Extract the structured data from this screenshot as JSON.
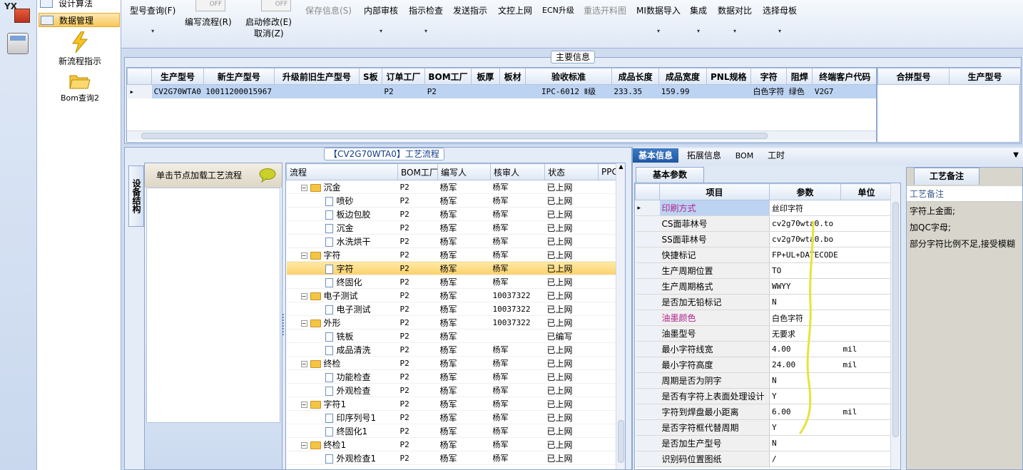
{
  "app": {
    "logo": "YX"
  },
  "nav": {
    "item1": "设计算法",
    "item2": "数据管理",
    "btn1": "新流程指示",
    "btn2": "Bom查询2"
  },
  "toolbar": {
    "b1": "型号查询(F)",
    "b2": "编写流程(R)",
    "b3": "启动修改(E)",
    "b3b": "取消(Z)",
    "b4": "保存信息(S)",
    "b5": "内部审核",
    "b6": "指示检查",
    "b7": "发送指示",
    "b8": "文控上网",
    "b9": "ECN升级",
    "b10": "重选开料图",
    "b11": "MI数据导入",
    "b12": "集成",
    "b13": "数据对比",
    "b14": "选择母板",
    "toggle": "OFF"
  },
  "main_info": {
    "caption": "主要信息",
    "headers": [
      "生产型号",
      "新生产型号",
      "升级前旧生产型号",
      "S板",
      "订单工厂",
      "BOM工厂",
      "板厚",
      "板材",
      "验收标准",
      "成品长度",
      "成品宽度",
      "PNL规格",
      "字符",
      "阻焊",
      "终端客户代码"
    ],
    "row": [
      "CV2G70WTA0",
      "10011200015967",
      "",
      "",
      "P2",
      "P2",
      "",
      "",
      "IPC-6012 Ⅱ级",
      "233.35",
      "159.99",
      "",
      "白色字符",
      "绿色",
      "V2G7"
    ],
    "side_headers": [
      "合拼型号",
      "生产型号"
    ]
  },
  "flow": {
    "caption": "【CV2G70WTA0】工艺流程",
    "side_tab": "设备结构",
    "hint": "单击节点加载工艺流程",
    "headers": [
      "流程",
      "BOM工厂",
      "编写人",
      "核审人",
      "状态",
      "PPC"
    ],
    "rows": [
      {
        "name": "沉金",
        "level": 0,
        "bom": "P2",
        "writer": "杨军",
        "checker": "杨军",
        "status": "已上网"
      },
      {
        "name": "喷砂",
        "level": 1,
        "bom": "P2",
        "writer": "杨军",
        "checker": "杨军",
        "status": "已上网"
      },
      {
        "name": "板边包胶",
        "level": 1,
        "bom": "P2",
        "writer": "杨军",
        "checker": "杨军",
        "status": "已上网"
      },
      {
        "name": "沉金",
        "level": 1,
        "bom": "P2",
        "writer": "杨军",
        "checker": "杨军",
        "status": "已上网"
      },
      {
        "name": "水洗烘干",
        "level": 1,
        "bom": "P2",
        "writer": "杨军",
        "checker": "杨军",
        "status": "已上网"
      },
      {
        "name": "字符",
        "level": 0,
        "bom": "P2",
        "writer": "杨军",
        "checker": "杨军",
        "status": "已上网"
      },
      {
        "name": "字符",
        "level": 1,
        "bom": "P2",
        "writer": "杨军",
        "checker": "杨军",
        "status": "已上网",
        "hl": true
      },
      {
        "name": "终固化",
        "level": 1,
        "bom": "P2",
        "writer": "杨军",
        "checker": "杨军",
        "status": "已上网"
      },
      {
        "name": "电子测试",
        "level": 0,
        "bom": "P2",
        "writer": "杨军",
        "checker": "10037322",
        "status": "已上网"
      },
      {
        "name": "电子测试",
        "level": 1,
        "bom": "P2",
        "writer": "杨军",
        "checker": "10037322",
        "status": "已上网"
      },
      {
        "name": "外形",
        "level": 0,
        "bom": "P2",
        "writer": "杨军",
        "checker": "10037322",
        "status": "已上网"
      },
      {
        "name": "铣板",
        "level": 1,
        "bom": "P2",
        "writer": "杨军",
        "checker": "",
        "status": "已编写"
      },
      {
        "name": "成品清洗",
        "level": 1,
        "bom": "P2",
        "writer": "杨军",
        "checker": "杨军",
        "status": "已上网"
      },
      {
        "name": "终检",
        "level": 0,
        "bom": "P2",
        "writer": "杨军",
        "checker": "杨军",
        "status": "已上网"
      },
      {
        "name": "功能检查",
        "level": 1,
        "bom": "P2",
        "writer": "杨军",
        "checker": "杨军",
        "status": "已上网"
      },
      {
        "name": "外观检查",
        "level": 1,
        "bom": "P2",
        "writer": "杨军",
        "checker": "杨军",
        "status": "已上网"
      },
      {
        "name": "字符1",
        "level": 0,
        "bom": "P2",
        "writer": "杨军",
        "checker": "杨军",
        "status": "已上网"
      },
      {
        "name": "印序列号1",
        "level": 1,
        "bom": "P2",
        "writer": "杨军",
        "checker": "杨军",
        "status": "已上网"
      },
      {
        "name": "终固化1",
        "level": 1,
        "bom": "P2",
        "writer": "杨军",
        "checker": "杨军",
        "status": "已上网"
      },
      {
        "name": "终检1",
        "level": 0,
        "bom": "P2",
        "writer": "杨军",
        "checker": "杨军",
        "status": "已上网"
      },
      {
        "name": "外观检查1",
        "level": 1,
        "bom": "P2",
        "writer": "杨军",
        "checker": "杨军",
        "status": "已上网"
      }
    ]
  },
  "right": {
    "tabs": [
      "基本信息",
      "拓展信息",
      "BOM",
      "工时"
    ],
    "sub_tab": "基本参数",
    "headers": [
      "项目",
      "参数",
      "单位"
    ],
    "params": [
      {
        "k": "印刷方式",
        "v": "丝印字符",
        "u": "",
        "mag": true
      },
      {
        "k": "CS面菲林号",
        "v": "cv2g70wta0.to",
        "u": ""
      },
      {
        "k": "SS面菲林号",
        "v": "cv2g70wta0.bo",
        "u": ""
      },
      {
        "k": "快捷标记",
        "v": "FP+UL+DATECODE",
        "u": ""
      },
      {
        "k": "生产周期位置",
        "v": "TO",
        "u": ""
      },
      {
        "k": "生产周期格式",
        "v": "WWYY",
        "u": ""
      },
      {
        "k": "是否加无铅标记",
        "v": "N",
        "u": ""
      },
      {
        "k": "油墨颜色",
        "v": "白色字符",
        "u": "",
        "mag": true
      },
      {
        "k": "油墨型号",
        "v": "无要求",
        "u": ""
      },
      {
        "k": "最小字符线宽",
        "v": "4.00",
        "u": "mil"
      },
      {
        "k": "最小字符高度",
        "v": "24.00",
        "u": "mil"
      },
      {
        "k": "周期是否为阴字",
        "v": "N",
        "u": ""
      },
      {
        "k": "是否有字符上表面处理设计",
        "v": "Y",
        "u": ""
      },
      {
        "k": "字符到焊盘最小距离",
        "v": "6.00",
        "u": "mil"
      },
      {
        "k": "是否字符框代替周期",
        "v": "Y",
        "u": ""
      },
      {
        "k": "是否加生产型号",
        "v": "N",
        "u": ""
      },
      {
        "k": "识别码位置图纸",
        "v": "/",
        "u": ""
      }
    ],
    "remarks_tab": "工艺备注",
    "remarks_header": "工艺备注",
    "remarks": [
      "字符上金面;",
      "加QC字母;",
      "部分字符比例不足,接受模糊"
    ]
  },
  "colors": {
    "highlight": "#fbd16b",
    "annotation": "#e8e23a",
    "magenta": "#b0238e"
  }
}
